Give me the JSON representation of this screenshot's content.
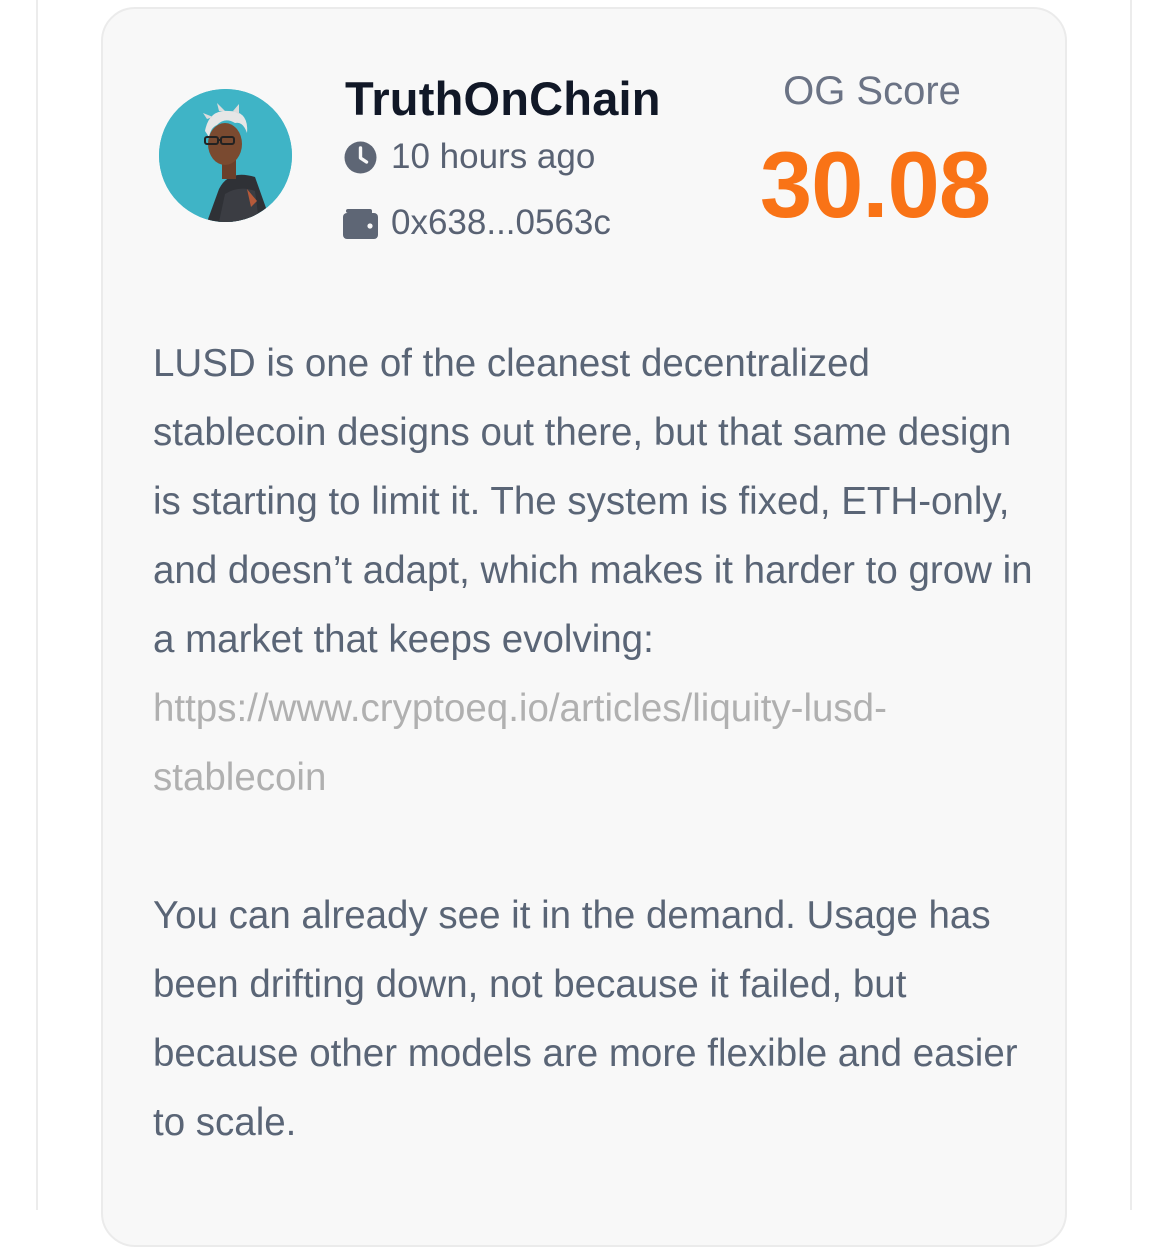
{
  "post": {
    "author": {
      "username": "TruthOnChain",
      "time": "10 hours ago",
      "wallet": "0x638...0563c",
      "avatar": "avatar"
    },
    "score": {
      "label": "OG Score",
      "value": "30.08"
    },
    "content": {
      "paragraph_1": "LUSD is one of the cleanest decentralized stablecoin designs out there, but that same design is starting to limit it. The system is fixed, ETH-only, and doesn’t adapt, which makes it harder to grow in a market that keeps evolving:",
      "link": "https://www.cryptoeq.io/articles/liquity-lusd-stablecoin",
      "paragraph_2": "You can already see it in the demand. Usage has been drifting down, not because it failed, but because other models are more flexible and easier to scale."
    }
  },
  "icons": {
    "time": "clock-icon",
    "wallet": "wallet-icon"
  },
  "colors": {
    "score": "#f97316",
    "username": "#111827",
    "body_text": "#5a6576",
    "link": "#b0b0b0",
    "card_background": "#f8f8f8"
  }
}
